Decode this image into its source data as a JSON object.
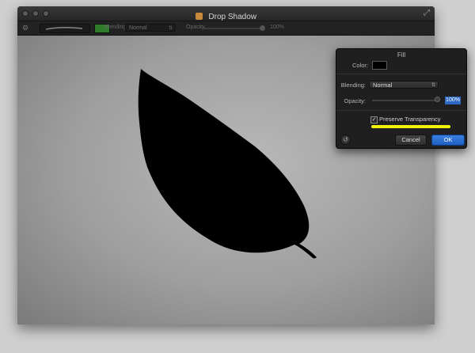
{
  "window": {
    "title": "Drop Shadow",
    "icons": [
      "close-icon",
      "minimize-icon",
      "zoom-icon",
      "fullscreen-icon"
    ]
  },
  "toolbar": {
    "brush_color": "#2f7c2a",
    "blending_label": "Blending",
    "blending_value": "Normal",
    "opacity_label": "Opacity",
    "opacity_value": "100%"
  },
  "canvas": {
    "shape": "leaf-silhouette",
    "shape_color": "#000000"
  },
  "fill_panel": {
    "title": "Fill",
    "color_label": "Color:",
    "color_value": "#000000",
    "blending_label": "Blending:",
    "blending_value": "Normal",
    "opacity_label": "Opacity:",
    "opacity_value": "100%",
    "opacity_fraction": 1.0,
    "preserve_transparency_label": "Preserve Transparency",
    "preserve_transparency_checked": true,
    "highlight_color": "#f2f20c",
    "cancel_label": "Cancel",
    "ok_label": "OK"
  }
}
